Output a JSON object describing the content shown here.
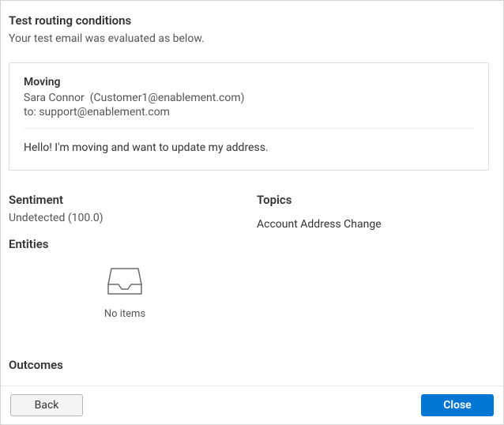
{
  "header": {
    "title": "Test routing conditions",
    "subtitle": "Your test email was evaluated as below."
  },
  "email": {
    "subject": "Moving",
    "from_name": "Sara Connor",
    "from_email": "(Customer1@enablement.com)",
    "to_prefix": "to:",
    "to_email": "support@enablement.com",
    "body": "Hello! I'm moving and want to update my address."
  },
  "sentiment": {
    "label": "Sentiment",
    "value": "Undetected (100.0)"
  },
  "topics": {
    "label": "Topics",
    "value": "Account Address Change"
  },
  "entities": {
    "label": "Entities",
    "empty_text": "No items"
  },
  "outcomes": {
    "label": "Outcomes"
  },
  "footer": {
    "back_label": "Back",
    "close_label": "Close"
  }
}
